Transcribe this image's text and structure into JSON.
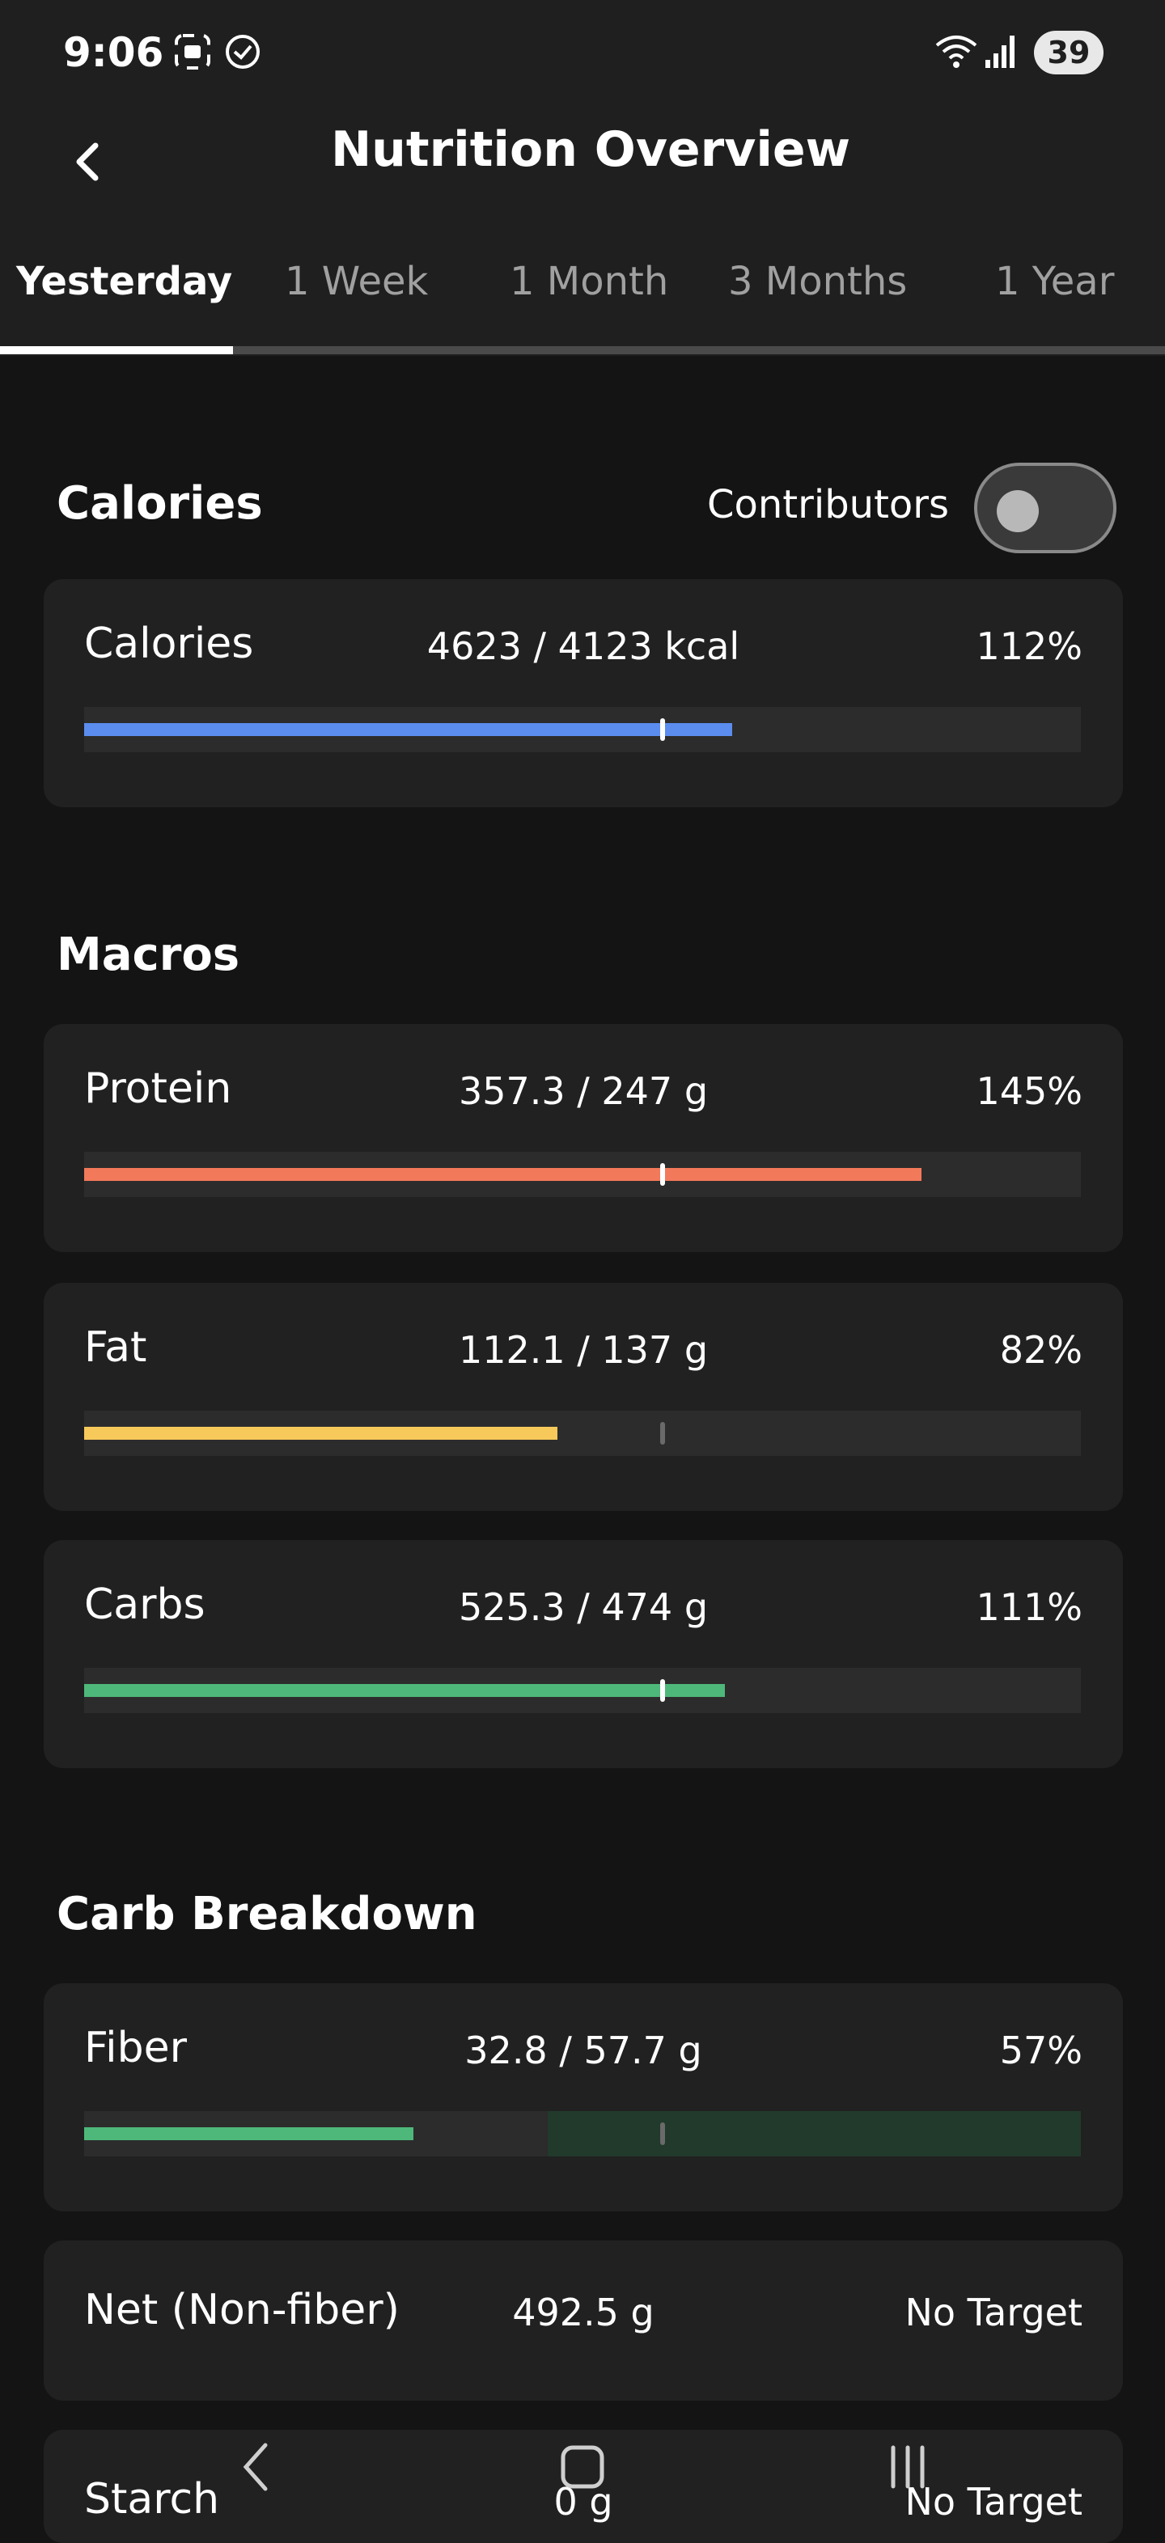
{
  "status_bar": {
    "time": "9:06",
    "battery": "39"
  },
  "header": {
    "title": "Nutrition Overview"
  },
  "tabs": [
    {
      "label": "Yesterday"
    },
    {
      "label": "1 Week"
    },
    {
      "label": "1 Month"
    },
    {
      "label": "3 Months"
    },
    {
      "label": "1 Year"
    }
  ],
  "calories": {
    "section_title": "Calories",
    "contributors_label": "Contributors",
    "contributors_enabled": false,
    "item": {
      "name": "Calories",
      "value": "4623 / 4123 kcal",
      "percent": "112%",
      "fill_fraction": 0.65,
      "color": "#5b8def"
    }
  },
  "macros": {
    "section_title": "Macros",
    "items": [
      {
        "name": "Protein",
        "value": "357.3 / 247 g",
        "percent": "145%",
        "fill_fraction": 0.84,
        "color": "#f2795a"
      },
      {
        "name": "Fat",
        "value": "112.1 / 137 g",
        "percent": "82%",
        "fill_fraction": 0.475,
        "color": "#f7c95a"
      },
      {
        "name": "Carbs",
        "value": "525.3 / 474 g",
        "percent": "111%",
        "fill_fraction": 0.643,
        "color": "#4eb87a"
      }
    ]
  },
  "carb_breakdown": {
    "section_title": "Carb Breakdown",
    "fiber": {
      "name": "Fiber",
      "value": "32.8 / 57.7 g",
      "percent": "57%",
      "fill_fraction": 0.33,
      "color": "#4eb87a",
      "target_zone_start": 0.465
    },
    "net": {
      "name": "Net (Non-fiber)",
      "value": "492.5 g",
      "percent": "No Target"
    },
    "starch": {
      "name": "Starch",
      "value": "0 g",
      "percent": "No Target"
    }
  }
}
